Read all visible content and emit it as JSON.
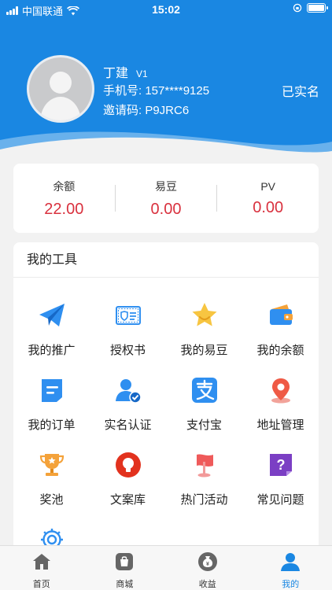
{
  "status_bar": {
    "carrier": "中国联通",
    "time": "15:02"
  },
  "profile": {
    "name": "丁建",
    "level": "V1",
    "phone": "手机号: 157****9125",
    "invite_code": "邀请码: P9JRC6",
    "verification_status": "已实名"
  },
  "balances": [
    {
      "label": "余额",
      "value": "22.00"
    },
    {
      "label": "易豆",
      "value": "0.00"
    },
    {
      "label": "PV",
      "value": "0.00"
    }
  ],
  "tools": {
    "title": "我的工具",
    "items": [
      {
        "label": "我的推广",
        "icon": "paper-plane-icon"
      },
      {
        "label": "授权书",
        "icon": "certificate-icon"
      },
      {
        "label": "我的易豆",
        "icon": "star-icon"
      },
      {
        "label": "我的余额",
        "icon": "wallet-icon"
      },
      {
        "label": "我的订单",
        "icon": "order-doc-icon"
      },
      {
        "label": "实名认证",
        "icon": "user-verified-icon"
      },
      {
        "label": "支付宝",
        "icon": "alipay-icon"
      },
      {
        "label": "地址管理",
        "icon": "location-pin-icon"
      },
      {
        "label": "奖池",
        "icon": "trophy-icon"
      },
      {
        "label": "文案库",
        "icon": "bulb-icon"
      },
      {
        "label": "热门活动",
        "icon": "flag-icon"
      },
      {
        "label": "常见问题",
        "icon": "question-icon"
      },
      {
        "label": "",
        "icon": "gear-icon"
      }
    ]
  },
  "tabbar": {
    "items": [
      {
        "label": "首页",
        "icon": "home-icon"
      },
      {
        "label": "商城",
        "icon": "shop-bag-icon"
      },
      {
        "label": "收益",
        "icon": "money-bag-icon"
      },
      {
        "label": "我的",
        "icon": "person-icon",
        "active": true
      }
    ]
  },
  "colors": {
    "header_blue": "#1a87e2",
    "value_red": "#d9313e"
  }
}
